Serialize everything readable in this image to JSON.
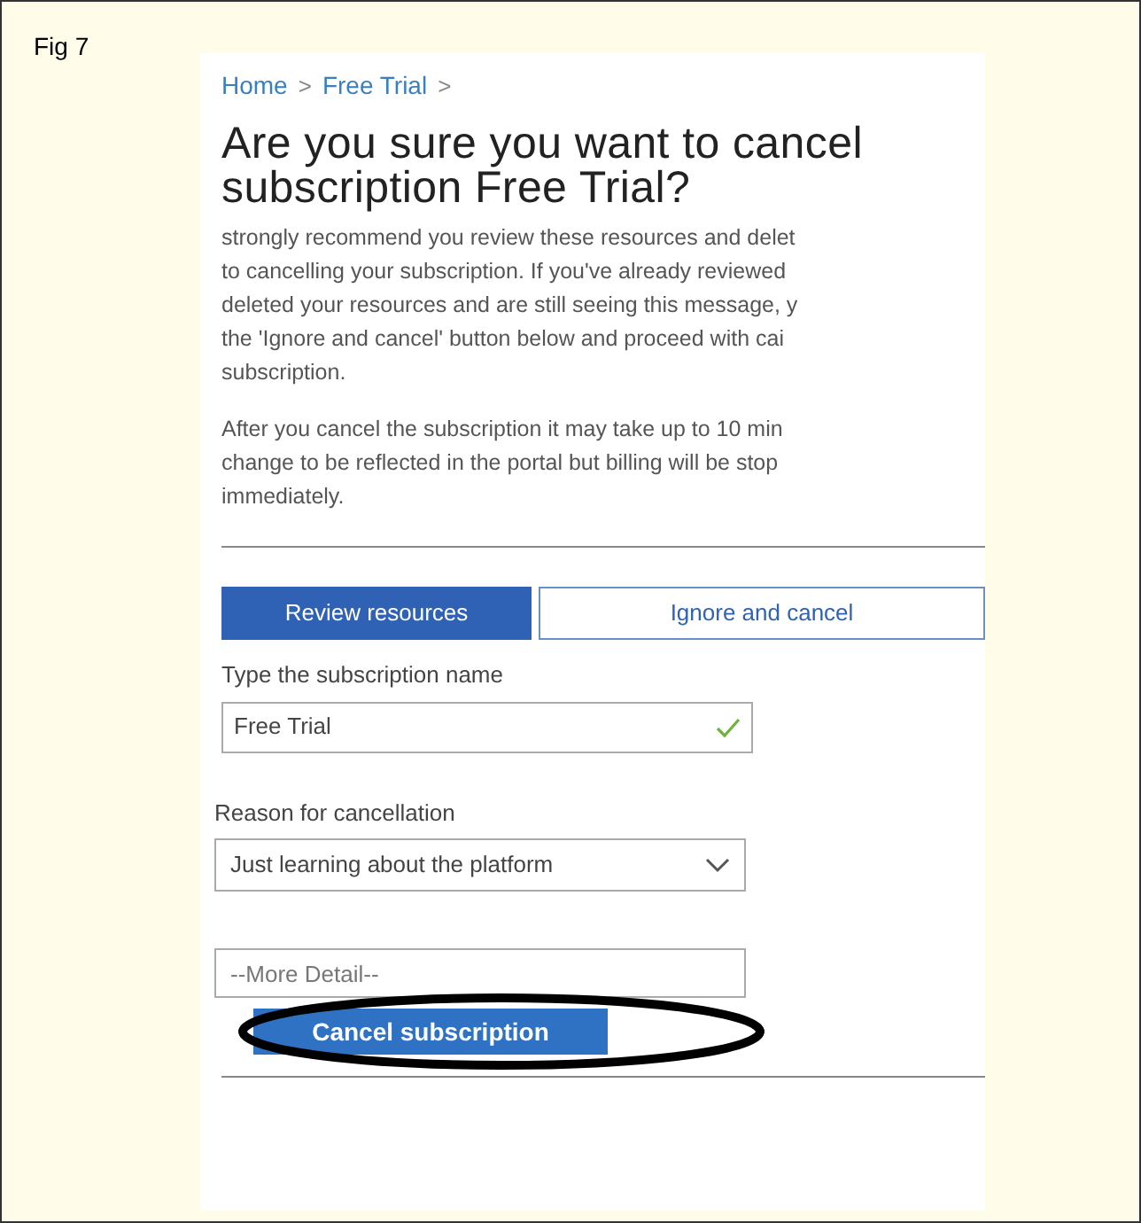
{
  "figure_label": "Fig 7",
  "breadcrumb": [
    "Home",
    "Free Trial"
  ],
  "breadcrumb_separator": ">",
  "heading": "Are you sure you want to cancel subscription Free Trial?",
  "paragraphs": [
    {
      "lines": [
        "strongly recommend you review these resources and delet",
        "to cancelling your subscription. If you've already reviewed",
        "deleted your resources and are still seeing this message, y",
        "the 'Ignore and cancel' button below and proceed with cai",
        "subscription."
      ]
    },
    {
      "lines": [
        "After you cancel the subscription it may take up to 10 min",
        "change to be reflected in the portal but billing will be stop",
        "immediately."
      ]
    }
  ],
  "action_buttons": [
    {
      "label": "Review resources",
      "kind": "primary"
    },
    {
      "label": "Ignore and cancel",
      "kind": "secondary"
    }
  ],
  "name_field": {
    "label": "Type the subscription name",
    "value": "Free Trial",
    "valid": true
  },
  "reason_field": {
    "label": "Reason for cancellation",
    "value": "Just learning about the platform"
  },
  "detail_field": {
    "placeholder": "--More Detail--"
  },
  "submit_button": {
    "label": "Cancel subscription",
    "circled": true
  }
}
